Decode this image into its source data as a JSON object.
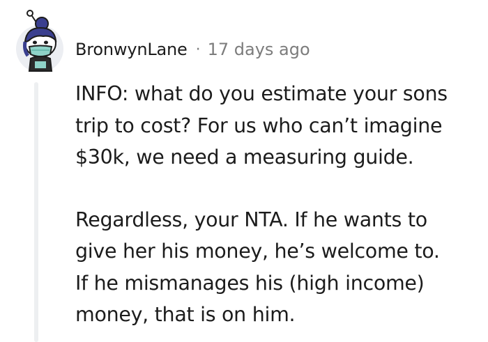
{
  "comment": {
    "author": "BronwynLane",
    "separator": "·",
    "timestamp": "17 days ago",
    "paragraphs": [
      {
        "lines": [
          "INFO: what do you estimate your sons",
          "trip to cost? For us who can’t imagine",
          "$30k, we need a measuring guide."
        ]
      },
      {
        "lines": [
          "Regardless, your NTA. If he wants to",
          "give her his money, he’s welcome to.",
          "If he mismanages his (high income)",
          "money, that is on him."
        ]
      }
    ]
  },
  "icons": {
    "avatar": "user-avatar-icon"
  },
  "colors": {
    "text": "#1c1c1c",
    "meta": "#7c7c7c",
    "thread_line": "#edeff1",
    "avatar_hair": "#3a3f8f",
    "avatar_mask": "#8fd3c8",
    "avatar_bg": "#e9e9ee"
  }
}
